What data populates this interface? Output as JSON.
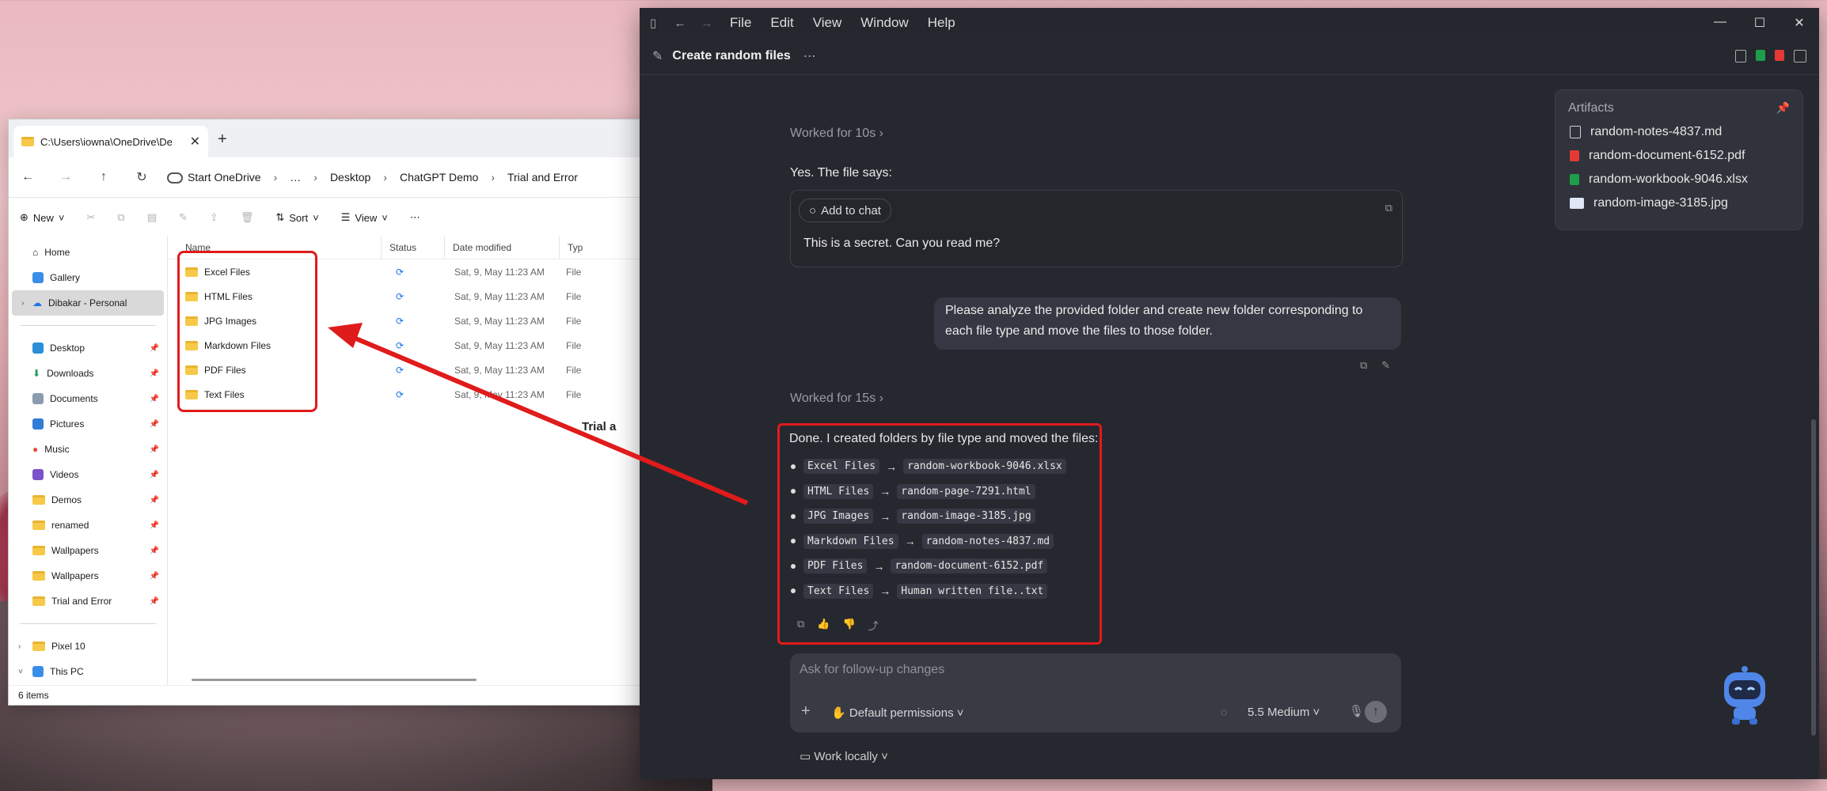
{
  "explorer": {
    "tab_title": "C:\\Users\\iowna\\OneDrive\\De",
    "breadcrumbs": [
      "Start OneDrive",
      "…",
      "Desktop",
      "ChatGPT Demo",
      "Trial and Error"
    ],
    "commands": {
      "new": "New",
      "sort": "Sort",
      "view": "View"
    },
    "nav_items": [
      {
        "label": "Home",
        "pinned": false
      },
      {
        "label": "Gallery",
        "pinned": false
      },
      {
        "label": "Dibakar - Personal",
        "pinned": false
      },
      {
        "label": "Desktop",
        "pinned": true
      },
      {
        "label": "Downloads",
        "pinned": true
      },
      {
        "label": "Documents",
        "pinned": true
      },
      {
        "label": "Pictures",
        "pinned": true
      },
      {
        "label": "Music",
        "pinned": true
      },
      {
        "label": "Videos",
        "pinned": true
      },
      {
        "label": "Demos",
        "pinned": true
      },
      {
        "label": "renamed",
        "pinned": true
      },
      {
        "label": "Wallpapers",
        "pinned": true
      },
      {
        "label": "Wallpapers",
        "pinned": true
      },
      {
        "label": "Trial and Error",
        "pinned": true
      },
      {
        "label": "Pixel 10",
        "pinned": false
      },
      {
        "label": "This PC",
        "pinned": false
      }
    ],
    "columns": {
      "name": "Name",
      "status": "Status",
      "date": "Date modified",
      "type": "Typ"
    },
    "files": [
      {
        "name": "Excel Files",
        "date": "Sat, 9, May 11:23 AM",
        "type": "File"
      },
      {
        "name": "HTML Files",
        "date": "Sat, 9, May 11:23 AM",
        "type": "File"
      },
      {
        "name": "JPG Images",
        "date": "Sat, 9, May 11:23 AM",
        "type": "File"
      },
      {
        "name": "Markdown Files",
        "date": "Sat, 9, May 11:23 AM",
        "type": "File"
      },
      {
        "name": "PDF Files",
        "date": "Sat, 9, May 11:23 AM",
        "type": "File"
      },
      {
        "name": "Text Files",
        "date": "Sat, 9, May 11:23 AM",
        "type": "File"
      }
    ],
    "status_bar": "6 items",
    "preview_fragment": "Trial a"
  },
  "app": {
    "menu": [
      "File",
      "Edit",
      "View",
      "Window",
      "Help"
    ],
    "thread_title": "Create random files",
    "worked_1": "Worked for 10s",
    "answer_1": "Yes. The file says:",
    "add_to_chat": "Add to chat",
    "quote_text": "This is a secret. Can you read me?",
    "user_message": "Please analyze the provided folder and create new folder corresponding to each file type and move the files to those folder.",
    "worked_2": "Worked for 15s",
    "response_head": "Done. I created folders by file type and moved the files:",
    "moves": [
      {
        "folder": "Excel Files",
        "file": "random-workbook-9046.xlsx"
      },
      {
        "folder": "HTML Files",
        "file": "random-page-7291.html"
      },
      {
        "folder": "JPG Images",
        "file": "random-image-3185.jpg"
      },
      {
        "folder": "Markdown Files",
        "file": "random-notes-4837.md"
      },
      {
        "folder": "PDF Files",
        "file": "random-document-6152.pdf"
      },
      {
        "folder": "Text Files",
        "file": "Human written file..txt"
      }
    ],
    "arrow_glyph": "→",
    "artifacts": {
      "heading": "Artifacts",
      "items": [
        {
          "name": "random-notes-4837.md",
          "color": "#cfcfcf"
        },
        {
          "name": "random-document-6152.pdf",
          "color": "#e53935"
        },
        {
          "name": "random-workbook-9046.xlsx",
          "color": "#1e9e4a"
        },
        {
          "name": "random-image-3185.jpg",
          "color": "#dfe6f5"
        }
      ]
    },
    "composer": {
      "placeholder": "Ask for follow-up changes",
      "permissions": "Default permissions",
      "model": "5.5 Medium"
    },
    "work_locally": "Work locally"
  },
  "colors": {
    "highlight_red": "#e01b1b",
    "app_bg": "#262830"
  }
}
